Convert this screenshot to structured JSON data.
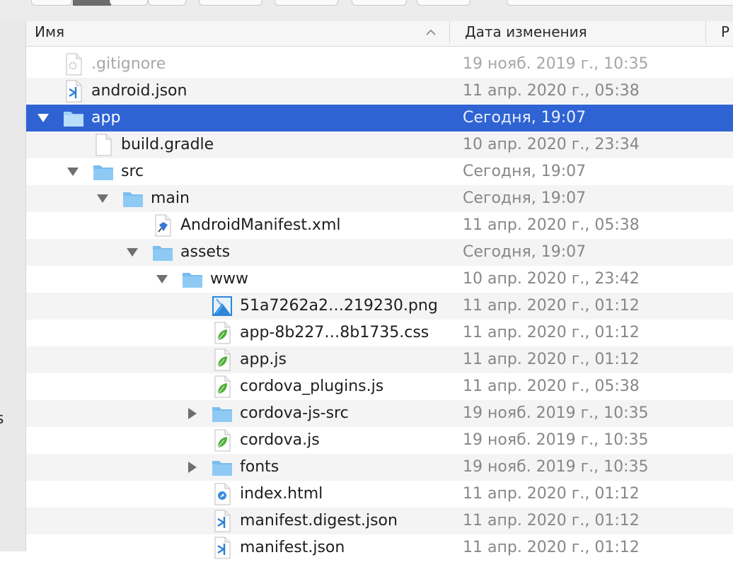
{
  "header": {
    "name_label": "Имя",
    "date_label": "Дата изменения",
    "third_label": "Р"
  },
  "sidebar": {
    "partial_text": "s"
  },
  "files": [
    {
      "name": ".gitignore",
      "date": "19 нояб. 2019 г., 10:35",
      "icon": "gear-file-icon",
      "level": 0,
      "disclosure": "none",
      "state": "dim"
    },
    {
      "name": "android.json",
      "date": "11 апр. 2020 г., 05:38",
      "icon": "vscode-file-icon",
      "level": 0,
      "disclosure": "none",
      "state": ""
    },
    {
      "name": "app",
      "date": "Сегодня, 19:07",
      "icon": "folder-icon",
      "level": 0,
      "disclosure": "open",
      "state": "selected"
    },
    {
      "name": "build.gradle",
      "date": "10 апр. 2020 г., 23:34",
      "icon": "blank-file-icon",
      "level": 1,
      "disclosure": "none",
      "state": ""
    },
    {
      "name": "src",
      "date": "Сегодня, 19:07",
      "icon": "folder-icon",
      "level": 1,
      "disclosure": "open",
      "state": ""
    },
    {
      "name": "main",
      "date": "Сегодня, 19:07",
      "icon": "folder-icon",
      "level": 2,
      "disclosure": "open",
      "state": ""
    },
    {
      "name": "AndroidManifest.xml",
      "date": "11 апр. 2020 г., 05:38",
      "icon": "xml-file-icon",
      "level": 3,
      "disclosure": "none",
      "state": ""
    },
    {
      "name": "assets",
      "date": "Сегодня, 19:07",
      "icon": "folder-icon",
      "level": 3,
      "disclosure": "open",
      "state": ""
    },
    {
      "name": "www",
      "date": "10 апр. 2020 г., 23:42",
      "icon": "folder-icon",
      "level": 4,
      "disclosure": "open",
      "state": ""
    },
    {
      "name": "51a7262a2…219230.png",
      "date": "11 апр. 2020 г., 01:12",
      "icon": "image-file-icon",
      "level": 5,
      "disclosure": "none",
      "state": ""
    },
    {
      "name": "app-8b227…8b1735.css",
      "date": "11 апр. 2020 г., 01:12",
      "icon": "leaf-file-icon",
      "level": 5,
      "disclosure": "none",
      "state": ""
    },
    {
      "name": "app.js",
      "date": "11 апр. 2020 г., 01:12",
      "icon": "leaf-file-icon",
      "level": 5,
      "disclosure": "none",
      "state": ""
    },
    {
      "name": "cordova_plugins.js",
      "date": "11 апр. 2020 г., 05:38",
      "icon": "leaf-file-icon",
      "level": 5,
      "disclosure": "none",
      "state": ""
    },
    {
      "name": "cordova-js-src",
      "date": "19 нояб. 2019 г., 10:35",
      "icon": "folder-icon",
      "level": 5,
      "disclosure": "closed",
      "state": ""
    },
    {
      "name": "cordova.js",
      "date": "19 нояб. 2019 г., 10:35",
      "icon": "leaf-file-icon",
      "level": 5,
      "disclosure": "none",
      "state": ""
    },
    {
      "name": "fonts",
      "date": "19 нояб. 2019 г., 10:35",
      "icon": "folder-icon",
      "level": 5,
      "disclosure": "closed",
      "state": ""
    },
    {
      "name": "index.html",
      "date": "11 апр. 2020 г., 01:12",
      "icon": "safari-file-icon",
      "level": 5,
      "disclosure": "none",
      "state": ""
    },
    {
      "name": "manifest.digest.json",
      "date": "11 апр. 2020 г., 01:12",
      "icon": "vscode-file-icon",
      "level": 5,
      "disclosure": "none",
      "state": ""
    },
    {
      "name": "manifest.json",
      "date": "11 апр. 2020 г., 01:12",
      "icon": "vscode-file-icon",
      "level": 5,
      "disclosure": "none",
      "state": ""
    }
  ],
  "colors": {
    "selection": "#2f63d4",
    "folder": "#7fc2f2",
    "leaf": "#4dae35",
    "vscode": "#2a7fd4"
  }
}
